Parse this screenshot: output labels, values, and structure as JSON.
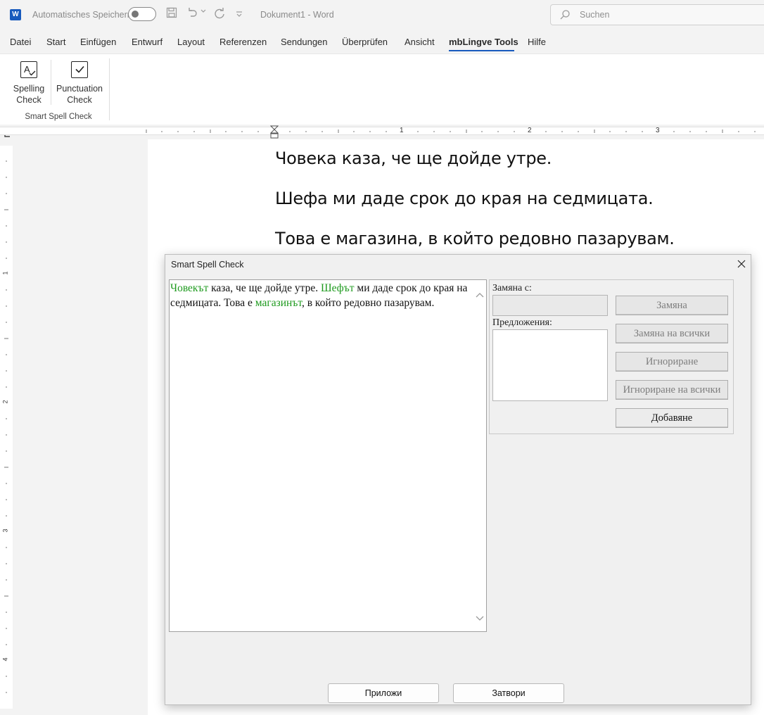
{
  "titlebar": {
    "logo": "W",
    "autosave_label": "Automatisches Speichern",
    "doc_title": "Dokument1  -  Word",
    "search_placeholder": "Suchen",
    "icons": [
      "save-icon",
      "undo-icon",
      "redo-icon",
      "customize-icon",
      "search-icon"
    ]
  },
  "menu": {
    "items": [
      "Datei",
      "Start",
      "Einfügen",
      "Entwurf",
      "Layout",
      "Referenzen",
      "Sendungen",
      "Überprüfen",
      "Ansicht",
      "mbLingve Tools",
      "Hilfe"
    ],
    "active": "mbLingve Tools",
    "accent_color": "#185abd"
  },
  "ribbon": {
    "spelling_line1": "Spelling",
    "spelling_line2": "Check",
    "punct_line1": "Punctuation",
    "punct_line2": "Check",
    "group_label": "Smart Spell Check"
  },
  "ruler": {
    "h_numbers": [
      "1",
      "2",
      "3"
    ],
    "v_numbers": [
      "1",
      "2",
      "3",
      "4"
    ]
  },
  "document": {
    "lines": [
      "Човека каза, че ще дойде утре.",
      "Шефа ми даде срок до края на седмицата.",
      "Това е магазина, в който редовно пазарувам."
    ]
  },
  "dialog": {
    "title": "Smart Spell Check",
    "text": {
      "w1": "Човекът",
      "t1": " каза, че ще дойде утре. ",
      "w2": "Шефът",
      "t2": " ми даде срок до края на седмицата. Това е ",
      "w3": "магазинът",
      "t3": ", в който редовно пазарувам."
    },
    "correction_color": "#1e9a1e",
    "replace_label": "Замяна с:",
    "replace_value": "",
    "suggestions_label": "Предложения:",
    "suggestions": [],
    "buttons": {
      "replace": "Замяна",
      "replace_all": "Замяна на всички",
      "ignore": "Игнориране",
      "ignore_all": "Игнориране на всички",
      "add": "Добавяне"
    },
    "apply": "Приложи",
    "close": "Затвори"
  }
}
